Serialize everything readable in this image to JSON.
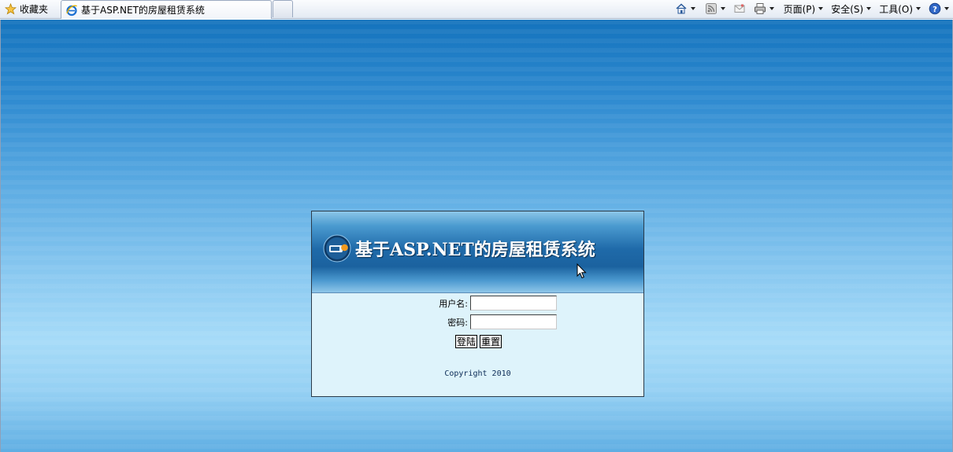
{
  "browser": {
    "favorites_label": "收藏夹",
    "tab_title": "基于ASP.NET的房屋租赁系统",
    "menus": {
      "page": "页面(P)",
      "safety": "安全(S)",
      "tools": "工具(O)"
    },
    "icons": [
      "star-icon",
      "ie-icon",
      "home-icon",
      "rss-icon",
      "mail-icon",
      "print-icon",
      "help-icon"
    ]
  },
  "login": {
    "banner_title": "基于ASP.NET的房屋租赁系统",
    "username_label": "用户名:",
    "password_label": "密码:",
    "username_value": "",
    "password_value": "",
    "login_button": "登陆",
    "reset_button": "重置",
    "copyright": "Copyright 2010"
  },
  "colors": {
    "page_top": "#1473bd",
    "page_mid": "#a6dbf8",
    "banner_dark": "#1b629f",
    "form_bg": "#def3fb"
  }
}
